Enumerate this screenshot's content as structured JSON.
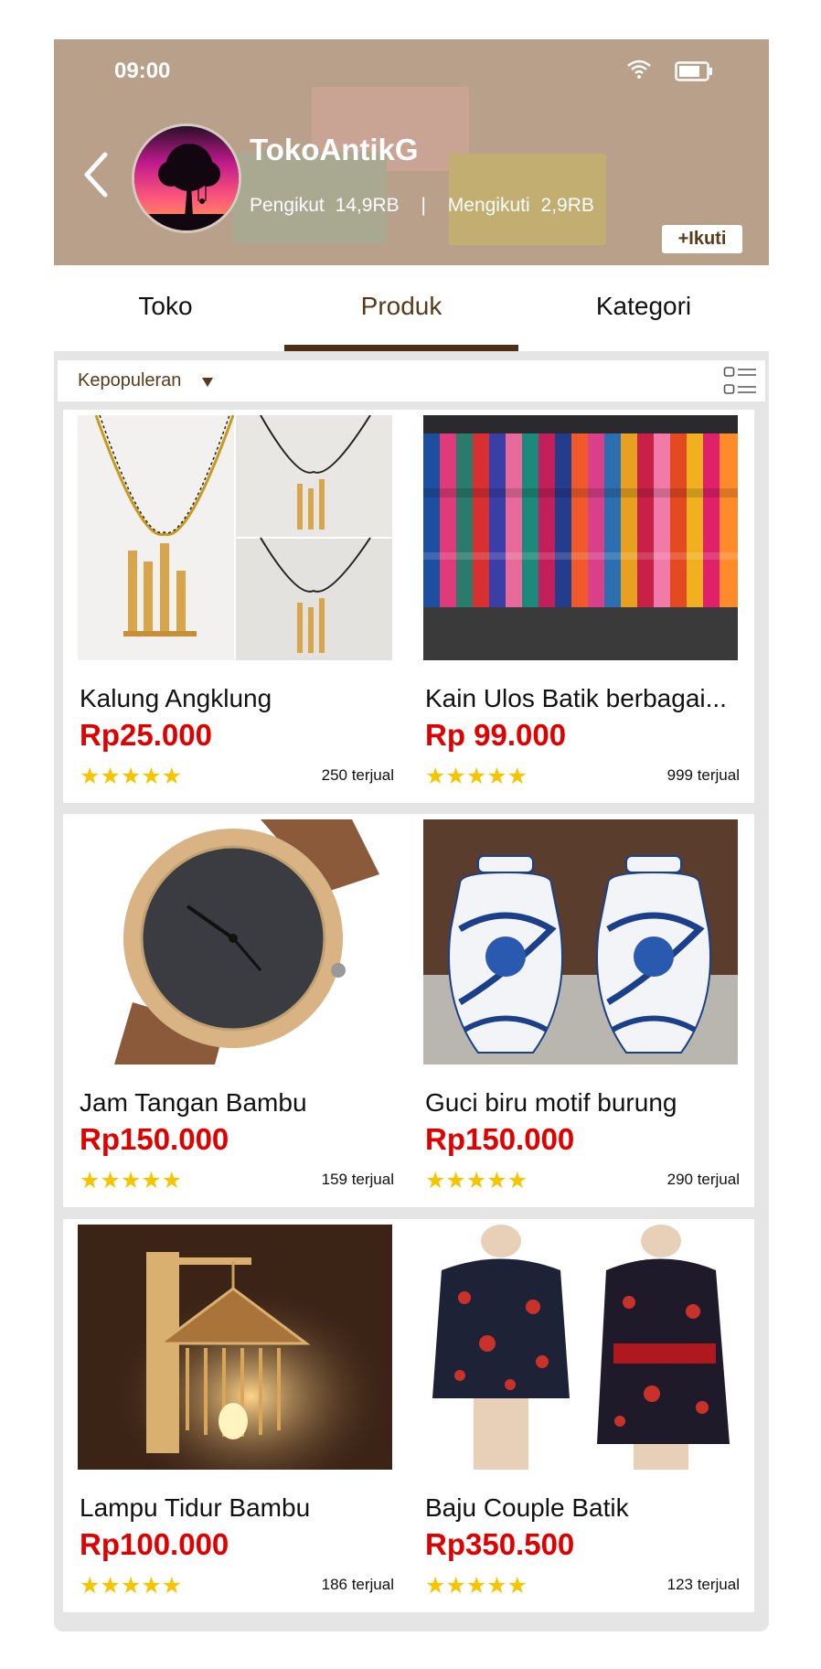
{
  "status_bar": {
    "time": "09:00",
    "wifi_icon": "wifi-icon",
    "battery_icon": "battery-icon"
  },
  "header": {
    "back_icon": "chevron-left-icon",
    "shop_name": "TokoAntikG",
    "followers_label": "Pengikut",
    "followers_count": "14,9RB",
    "separator": "|",
    "following_label": "Mengikuti",
    "following_count": "2,9RB",
    "follow_button": "+Ikuti"
  },
  "tabs": [
    {
      "label": "Toko",
      "active": false
    },
    {
      "label": "Produk",
      "active": true
    },
    {
      "label": "Kategori",
      "active": false
    }
  ],
  "filter": {
    "sort_label": "Kepopuleran",
    "caret_icon": "caret-down-icon",
    "view_icon": "list-view-icon"
  },
  "products": [
    {
      "name": "Kalung Angklung",
      "price": "Rp25.000",
      "rating_icon": "five-stars-icon",
      "stars": "★★★★★",
      "sold": "250 terjual"
    },
    {
      "name": "Kain Ulos Batik berbagai...",
      "price": "Rp 99.000",
      "rating_icon": "five-stars-icon",
      "stars": "★★★★★",
      "sold": "999 terjual"
    },
    {
      "name": "Jam Tangan Bambu",
      "price": "Rp150.000",
      "rating_icon": "five-stars-icon",
      "stars": "★★★★★",
      "sold": "159 terjual"
    },
    {
      "name": "Guci biru motif burung",
      "price": "Rp150.000",
      "rating_icon": "five-stars-icon",
      "stars": "★★★★★",
      "sold": "290 terjual"
    },
    {
      "name": "Lampu Tidur Bambu",
      "price": "Rp100.000",
      "rating_icon": "five-stars-icon",
      "stars": "★★★★★",
      "sold": "186 terjual"
    },
    {
      "name": "Baju Couple Batik",
      "price": "Rp350.500",
      "rating_icon": "five-stars-icon",
      "stars": "★★★★★",
      "sold": "123 terjual"
    }
  ],
  "colors": {
    "header_bg": "#b8a08a",
    "accent": "#4e2e14",
    "price": "#e00000",
    "star": "#f7c400"
  }
}
